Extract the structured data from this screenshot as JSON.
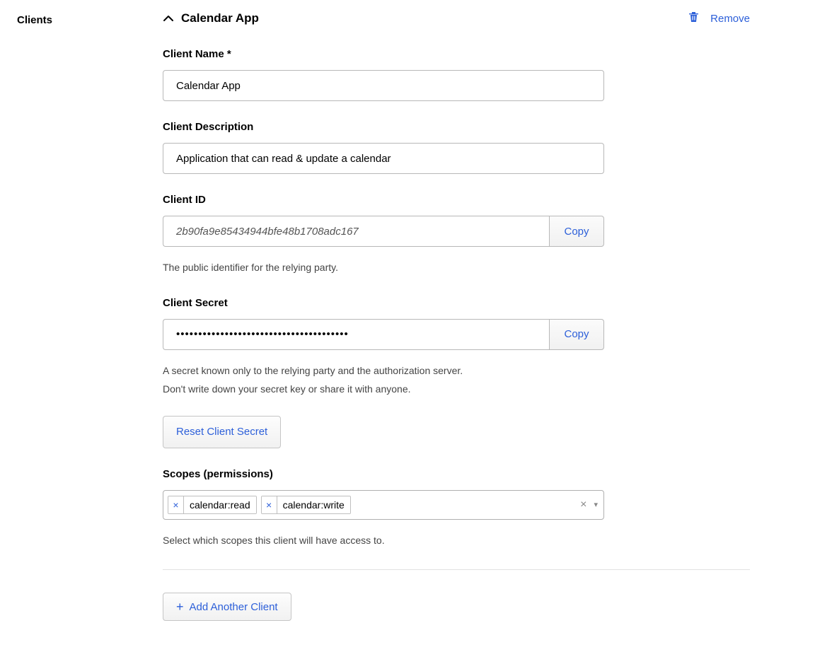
{
  "sidebar": {
    "label": "Clients"
  },
  "header": {
    "title": "Calendar App",
    "remove_label": "Remove"
  },
  "fields": {
    "name": {
      "label": "Client Name *",
      "value": "Calendar App"
    },
    "description": {
      "label": "Client Description",
      "value": "Application that can read & update a calendar"
    },
    "client_id": {
      "label": "Client ID",
      "value": "2b90fa9e85434944bfe48b1708adc167",
      "copy": "Copy",
      "help": "The public identifier for the relying party."
    },
    "client_secret": {
      "label": "Client Secret",
      "value": "•••••••••••••••••••••••••••••••••••••••",
      "copy": "Copy",
      "help1": "A secret known only to the relying party and the authorization server.",
      "help2": "Don't write down your secret key or share it with anyone.",
      "reset_label": "Reset Client Secret"
    },
    "scopes": {
      "label": "Scopes (permissions)",
      "tags": [
        "calendar:read",
        "calendar:write"
      ],
      "help": "Select which scopes this client will have access to."
    }
  },
  "footer": {
    "add_label": "Add Another Client"
  },
  "glyphs": {
    "tag_x": "×",
    "clear_x": "×",
    "caret": "▾",
    "plus": "+"
  }
}
